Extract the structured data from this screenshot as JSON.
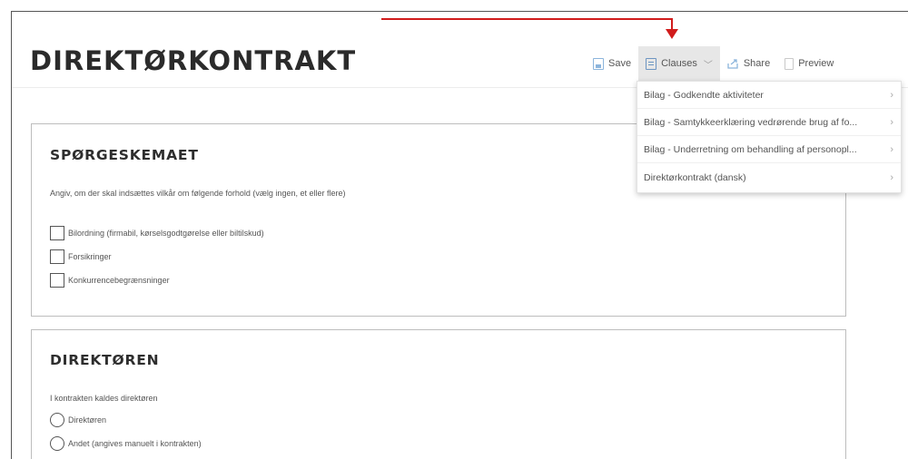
{
  "page": {
    "title": "DIREKTØRKONTRAKT"
  },
  "toolbar": {
    "save_label": "Save",
    "clauses_label": "Clauses",
    "share_label": "Share",
    "preview_label": "Preview"
  },
  "clauses_menu": {
    "items": [
      {
        "label": "Bilag - Godkendte aktiviteter"
      },
      {
        "label": "Bilag - Samtykkeerklæring vedrørende brug af fo..."
      },
      {
        "label": "Bilag - Underretning om behandling af personopl..."
      },
      {
        "label": "Direktørkontrakt (dansk)"
      }
    ]
  },
  "sections": [
    {
      "title": "SPØRGESKEMAET",
      "question": "Angiv, om der skal indsættes vilkår om følgende forhold (vælg ingen, et eller flere)",
      "options": [
        {
          "label": "Bilordning (firmabil, kørselsgodtgørelse eller biltilskud)"
        },
        {
          "label": "Forsikringer"
        },
        {
          "label": "Konkurrencebegrænsninger"
        }
      ]
    },
    {
      "title": "DIREKTØREN",
      "question": "I kontrakten kaldes direktøren",
      "options": [
        {
          "label": "Direktøren"
        },
        {
          "label": "Andet (angives manuelt i kontrakten)"
        }
      ]
    }
  ],
  "colors": {
    "annotation_arrow": "#d11c1c",
    "active_tool_bg": "#e7e7e7",
    "icon_blue": "#6d95c2"
  }
}
